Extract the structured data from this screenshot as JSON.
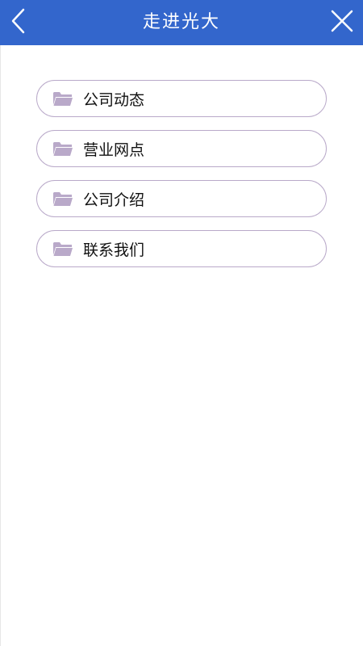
{
  "header": {
    "title": "走进光大",
    "back_icon": "chevron-left-icon",
    "close_icon": "close-icon",
    "background_color": "#3366cc"
  },
  "menu": {
    "items": [
      {
        "label": "公司动态",
        "icon": "folder-open-icon"
      },
      {
        "label": "营业网点",
        "icon": "folder-open-icon"
      },
      {
        "label": "公司介绍",
        "icon": "folder-open-icon"
      },
      {
        "label": "联系我们",
        "icon": "folder-open-icon"
      }
    ],
    "border_color": "#b9a9c9",
    "icon_color": "#b9a9c9"
  }
}
